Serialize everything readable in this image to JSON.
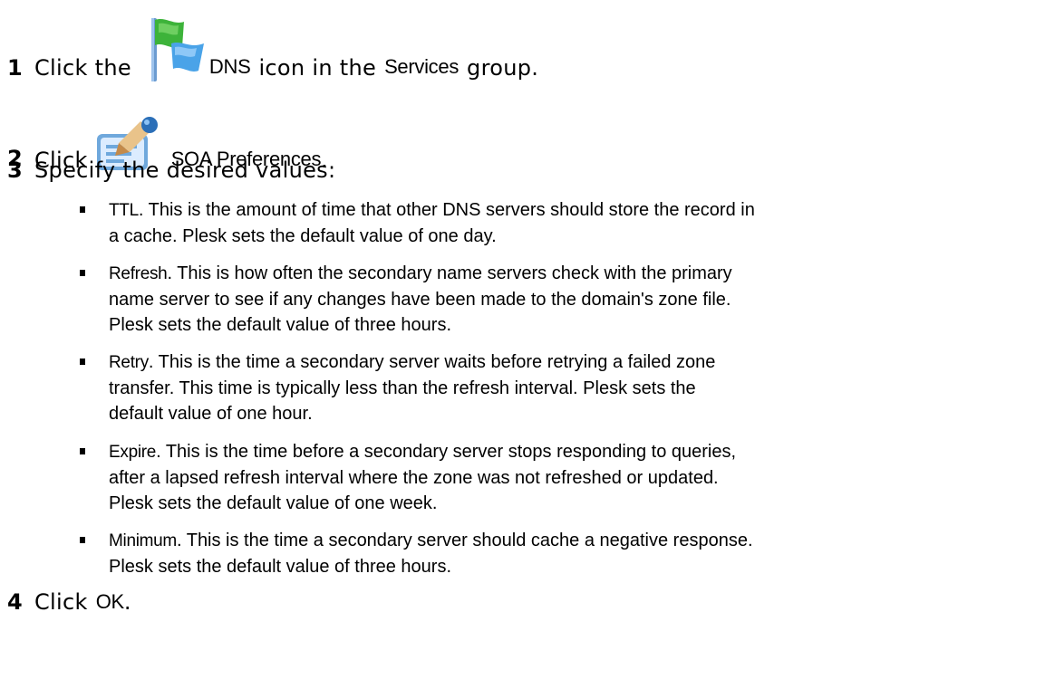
{
  "steps": [
    {
      "number": "1",
      "before": "Click the",
      "icon": "dns-flag-icon",
      "term": "DNS",
      "after": "icon in the",
      "term2": "Services",
      "after2": "group."
    },
    {
      "number": "2",
      "before": "Click",
      "icon": "soa-preferences-icon",
      "term": "SOA Preferences",
      "after": "."
    },
    {
      "number": "3",
      "text": "Specify the desired values:"
    },
    {
      "number": "4",
      "before": "Click",
      "term": "OK",
      "after": "."
    }
  ],
  "values": [
    {
      "term": "TTL",
      "lines": [
        ". This is the amount of time that other DNS servers should store the record in",
        "a cache. Plesk sets the default value of one day."
      ]
    },
    {
      "term": "Refresh",
      "lines": [
        ". This is how often the secondary name servers check with the primary",
        "name server to see if any changes have been made to the domain's zone file.",
        "Plesk sets the default value of three hours."
      ]
    },
    {
      "term": "Retry",
      "lines": [
        ". This is the time a secondary server waits before retrying a failed zone",
        "transfer. This time is typically less than the refresh interval. Plesk sets the",
        "default value of one hour."
      ]
    },
    {
      "term": "Expire",
      "lines": [
        ". This is the time before a secondary server stops responding to queries,",
        "after a lapsed refresh interval where the zone was not refreshed or updated.",
        "Plesk sets the default value of one week."
      ]
    },
    {
      "term": "Minimum",
      "lines": [
        ". This is the time a secondary server should cache a negative response.",
        "Plesk sets the default value of three hours."
      ]
    }
  ],
  "colors": {
    "flag_green": "#3db33a",
    "flag_blue": "#4aa3e8",
    "pole": "#6b9bd1",
    "card_blue": "#6fa8dc",
    "pencil_tan": "#e9c38a"
  }
}
